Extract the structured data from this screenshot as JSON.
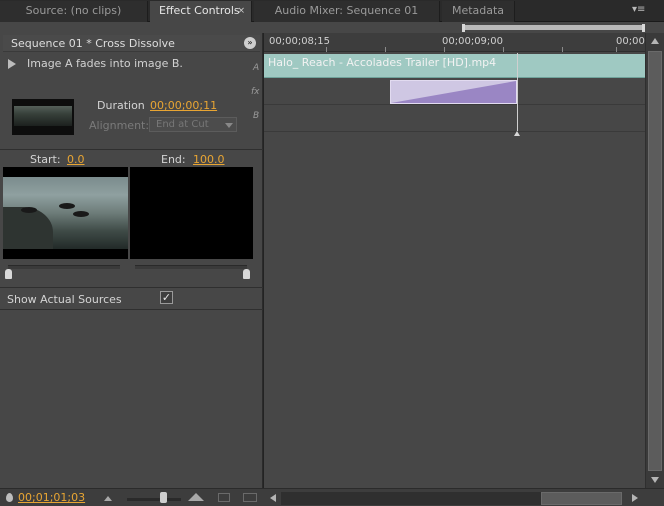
{
  "tabs": [
    {
      "label": "Source: (no clips)",
      "active": false
    },
    {
      "label": "Effect Controls",
      "active": true
    },
    {
      "label": "Audio Mixer: Sequence 01",
      "active": false
    },
    {
      "label": "Metadata",
      "active": false
    }
  ],
  "tab_close_glyph": "×",
  "panel_menu_glyph": "▾≡",
  "effect": {
    "sequence_title": "Sequence 01 * Cross Dissolve",
    "description": "Image A fades into image B.",
    "duration_label": "Duration",
    "duration_value": "00;00;00;11",
    "alignment_label": "Alignment:",
    "alignment_value": "End at Cut",
    "start_label": "Start:",
    "start_value": "0.0",
    "end_label": "End:",
    "end_value": "100.0",
    "show_actual_label": "Show Actual Sources",
    "show_actual_checked": "✓",
    "play_icon": "play-triangle"
  },
  "timeline": {
    "ruler_labels": [
      "00;00;08;15",
      "00;00;09;00",
      "00;00;"
    ],
    "track_a_label": "A",
    "fx_label": "fx",
    "track_b_label": "B",
    "clip_a_name": "Halo_ Reach - Accolades  Trailer [HD].mp4"
  },
  "bottom": {
    "timecode": "00;01;01;03"
  },
  "colors": {
    "accent_timecode": "#e8a533",
    "clip_a": "#9fc9c2",
    "transition": "#cfc7e3",
    "panel_bg": "#474747"
  }
}
